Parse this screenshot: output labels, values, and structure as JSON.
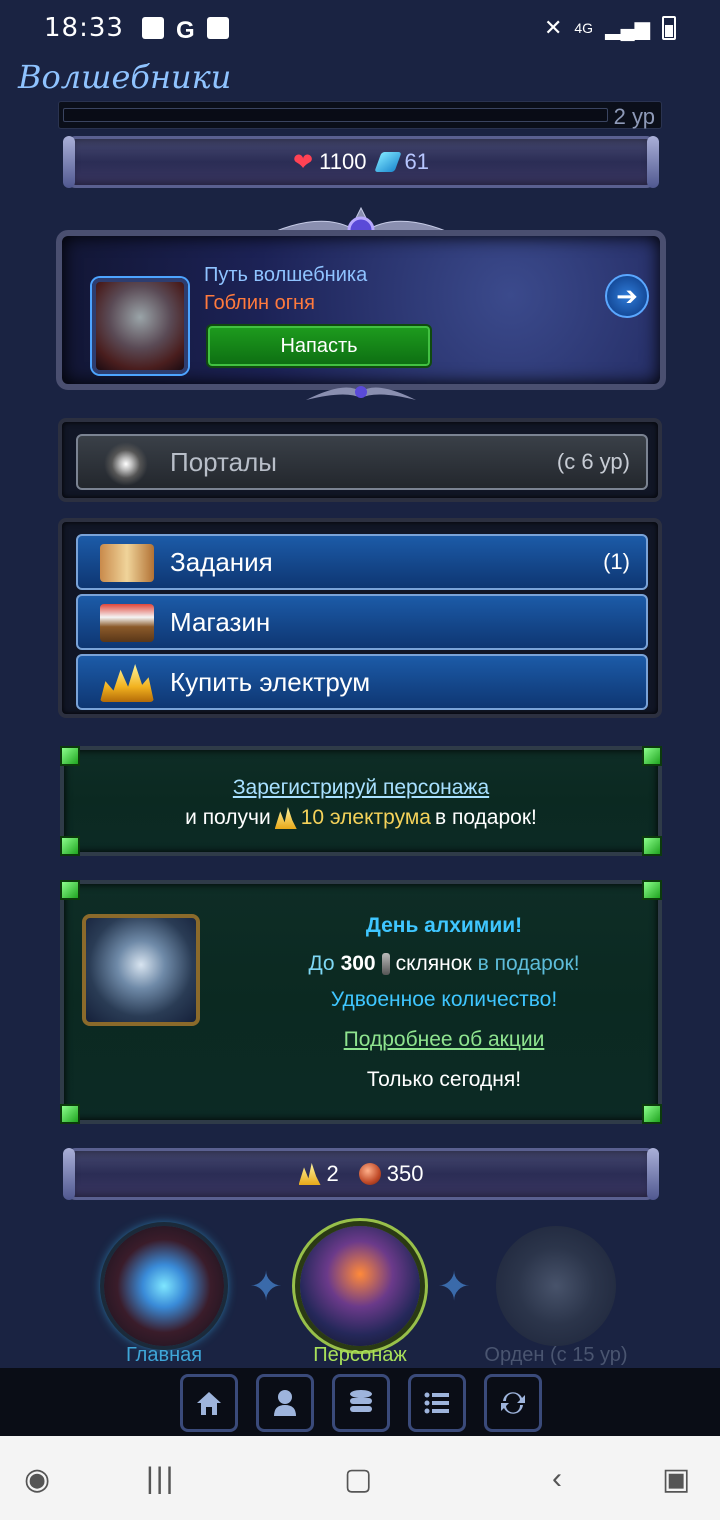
{
  "statusbar": {
    "time": "18:33",
    "google": "G",
    "net": "4G"
  },
  "app": {
    "title": "Волшебники"
  },
  "player": {
    "level_label": "2 ур",
    "hp": "1100",
    "gems": "61"
  },
  "quest": {
    "path": "Путь волшебника",
    "enemy": "Гоблин огня",
    "attack_label": "Напасть"
  },
  "portals": {
    "label": "Порталы",
    "requirement": "(с 6 ур)"
  },
  "menu": {
    "items": [
      {
        "label": "Задания",
        "count": "(1)"
      },
      {
        "label": "Магазин",
        "count": ""
      },
      {
        "label": "Купить электрум",
        "count": ""
      }
    ]
  },
  "register": {
    "link": "Зарегистрируй персонажа",
    "text_before": "и получи",
    "highlight": "10 электрума",
    "text_after": "в подарок!"
  },
  "alchemy": {
    "title": "День алхимии!",
    "line_prefix": "До",
    "amount": "300",
    "line_mid": "склянок",
    "line_suffix": "в подарок!",
    "double": "Удвоенное количество!",
    "more_link": "Подробнее об акции",
    "today": "Только сегодня!"
  },
  "currency": {
    "electrum": "2",
    "copper": "350"
  },
  "nav": {
    "main": "Главная",
    "character": "Персонаж",
    "order": "Орден (с 15 ур)"
  },
  "colors": {
    "nav_main": "#3fa6d8",
    "nav_character": "#a8e05a",
    "nav_order": "#4a5570"
  }
}
